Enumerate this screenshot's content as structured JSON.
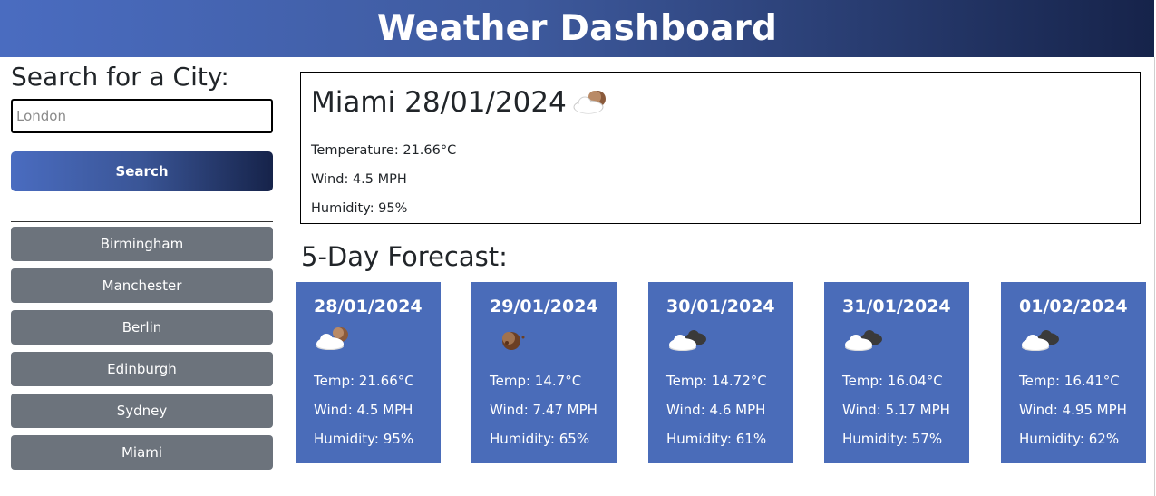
{
  "header": {
    "title": "Weather Dashboard"
  },
  "search": {
    "title": "Search for a City:",
    "placeholder": "London",
    "button_label": "Search"
  },
  "history": [
    "Birmingham",
    "Manchester",
    "Berlin",
    "Edinburgh",
    "Sydney",
    "Miami"
  ],
  "current": {
    "city": "Miami",
    "date": "28/01/2024",
    "icon": "partly-cloudy-night-icon",
    "temperature": "Temperature: 21.66°C",
    "wind": "Wind: 4.5 MPH",
    "humidity": "Humidity: 95%"
  },
  "forecast": {
    "title": "5-Day Forecast:",
    "days": [
      {
        "date": "28/01/2024",
        "icon": "partly-cloudy-night-icon",
        "temp": "Temp: 21.66°C",
        "wind": "Wind: 4.5 MPH",
        "humidity": "Humidity: 95%"
      },
      {
        "date": "29/01/2024",
        "icon": "clear-night-icon",
        "temp": "Temp: 14.7°C",
        "wind": "Wind: 7.47 MPH",
        "humidity": "Humidity: 65%"
      },
      {
        "date": "30/01/2024",
        "icon": "broken-clouds-icon",
        "temp": "Temp: 14.72°C",
        "wind": "Wind: 4.6 MPH",
        "humidity": "Humidity: 61%"
      },
      {
        "date": "31/01/2024",
        "icon": "broken-clouds-icon",
        "temp": "Temp: 16.04°C",
        "wind": "Wind: 5.17 MPH",
        "humidity": "Humidity: 57%"
      },
      {
        "date": "01/02/2024",
        "icon": "broken-clouds-icon",
        "temp": "Temp: 16.41°C",
        "wind": "Wind: 4.95 MPH",
        "humidity": "Humidity: 62%"
      }
    ]
  },
  "colors": {
    "header_gradient_start": "#4a6cc0",
    "header_gradient_end": "#16234a",
    "card_bg": "#4a6cb9",
    "history_button_bg": "#6c737c"
  }
}
